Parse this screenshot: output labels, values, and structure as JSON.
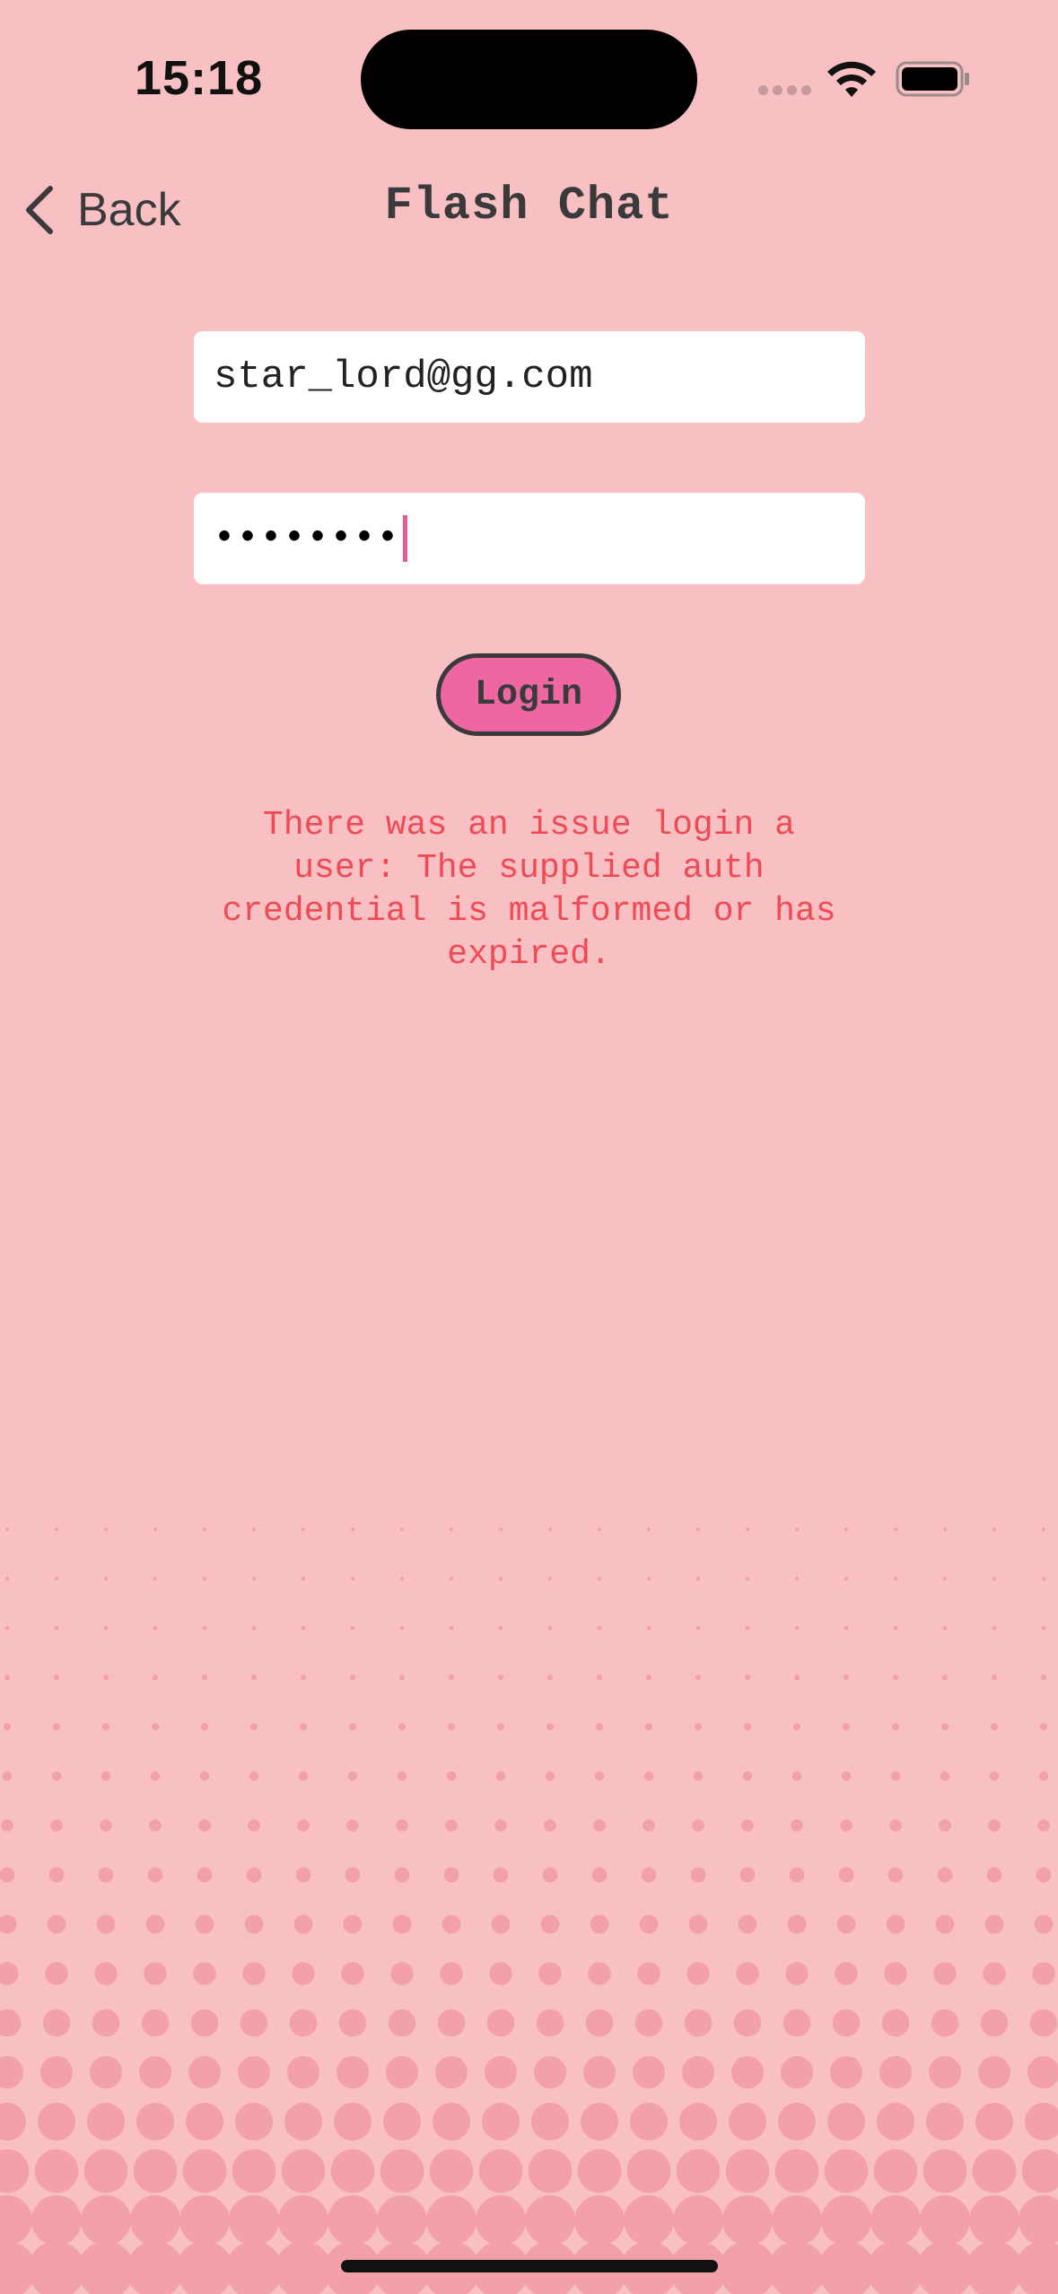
{
  "status_bar": {
    "time": "15:18"
  },
  "nav": {
    "back_label": "Back",
    "title": "Flash Chat"
  },
  "form": {
    "email_value": "star_lord@gg.com",
    "password_mask": "••••••••",
    "login_label": "Login"
  },
  "error": {
    "message": "There was an issue login a user: The supplied auth credential is malformed or has expired."
  },
  "colors": {
    "background": "#F9C0C4",
    "accent": "#EE66A2",
    "error": "#F04A55",
    "text": "#3A3A3C",
    "halftone": "#F2A1AA"
  },
  "icons": {
    "back": "chevron-left-icon",
    "wifi": "wifi-icon",
    "battery": "battery-icon",
    "signal": "signal-dots-icon"
  }
}
